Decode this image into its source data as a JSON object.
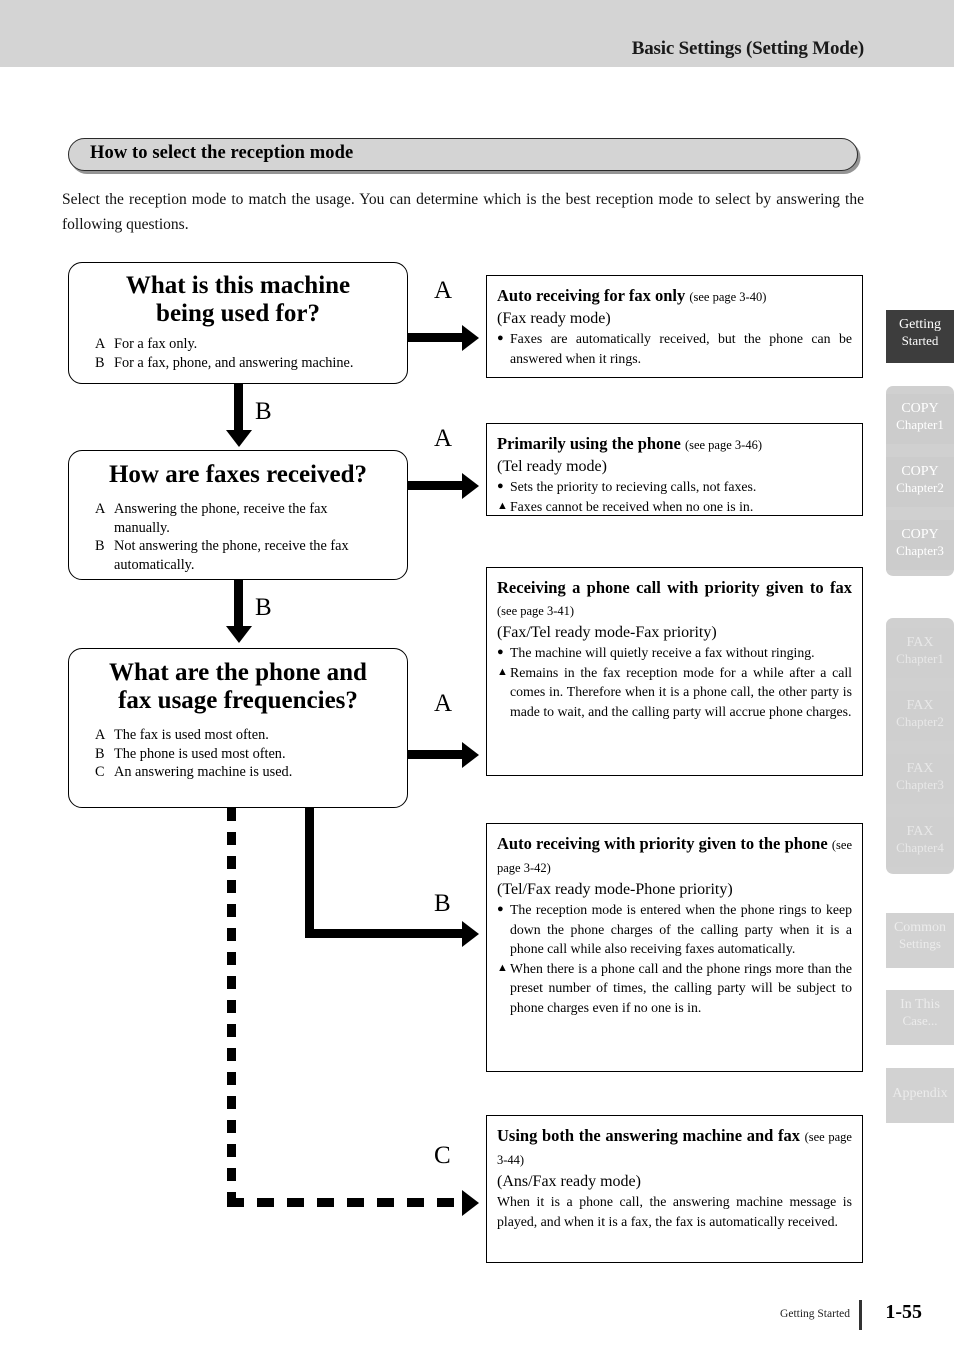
{
  "header": {
    "title": "Basic Settings (Setting Mode)"
  },
  "section": {
    "title": "How to select the reception mode",
    "intro": "Select the reception mode to match the usage. You can determine which is the best reception mode to select by answering the following questions."
  },
  "flow": {
    "questions": [
      {
        "title_line1": "What is this machine",
        "title_line2": "being used for?",
        "options": [
          {
            "letter": "A",
            "text": "For a fax only."
          },
          {
            "letter": "B",
            "text": "For a fax, phone, and answering machine."
          }
        ]
      },
      {
        "title_line1": "How are faxes received?",
        "title_line2": "",
        "options": [
          {
            "letter": "A",
            "text": "Answering the phone, receive the fax manually."
          },
          {
            "letter": "B",
            "text": "Not answering the phone, receive the fax automatically."
          }
        ]
      },
      {
        "title_line1": "What are the phone and",
        "title_line2": "fax usage frequencies?",
        "options": [
          {
            "letter": "A",
            "text": "The fax is used most often."
          },
          {
            "letter": "B",
            "text": "The phone is used most often."
          },
          {
            "letter": "C",
            "text": "An answering machine is used."
          }
        ]
      }
    ],
    "branch_labels": {
      "q1_right": "A",
      "q1_down": "B",
      "q2_right": "A",
      "q2_down": "B",
      "q3_right": "A",
      "q3_mid": "B",
      "q3_dashed": "C"
    },
    "results": [
      {
        "heading": "Auto receiving for fax only",
        "pageref": "(see page 3-40)",
        "mode": "(Fax ready mode)",
        "bullets": [
          {
            "mark": "●",
            "text": "Faxes are automatically received, but the phone can be answered when it rings."
          }
        ],
        "plain": ""
      },
      {
        "heading": "Primarily using the phone",
        "pageref": "(see page 3-46)",
        "mode": "(Tel ready mode)",
        "bullets": [
          {
            "mark": "●",
            "text": "Sets the priority to recieving calls, not faxes."
          },
          {
            "mark": "▲",
            "text": "Faxes cannot be received when no one is in."
          }
        ],
        "plain": ""
      },
      {
        "heading": "Receiving a phone call with priority given to fax",
        "pageref": "(see page 3-41)",
        "mode": "(Fax/Tel ready mode-Fax priority)",
        "bullets": [
          {
            "mark": "●",
            "text": "The machine will quietly receive a fax without ringing."
          },
          {
            "mark": "▲",
            "text": "Remains in the fax reception mode for a while after a call comes in. Therefore when it is a phone call, the other party is made to wait, and the calling party will accrue phone charges."
          }
        ],
        "plain": ""
      },
      {
        "heading": "Auto receiving with priority given to the phone",
        "pageref": "(see page 3-42)",
        "mode": "(Tel/Fax ready mode-Phone priority)",
        "bullets": [
          {
            "mark": "●",
            "text": "The reception mode is entered when the phone rings to keep down the phone charges of the calling party when it is a phone call while also receiving faxes automatically."
          },
          {
            "mark": "▲",
            "text": "When there is a phone call and the phone rings more than the preset number of times, the calling party will be subject to phone charges even if no one is in."
          }
        ],
        "plain": ""
      },
      {
        "heading": "Using both the answering machine and fax",
        "pageref": "(see page 3-44)",
        "mode": "(Ans/Fax ready mode)",
        "bullets": [],
        "plain": "When it is a phone call, the answering machine message is played, and when it is a fax, the fax is automatically received."
      }
    ]
  },
  "tabs": [
    {
      "line1": "Getting",
      "line2": "Started",
      "state": "current"
    },
    {
      "line1": "COPY",
      "line2": "Chapter1",
      "state": "group"
    },
    {
      "line1": "COPY",
      "line2": "Chapter2",
      "state": "group"
    },
    {
      "line1": "COPY",
      "line2": "Chapter3",
      "state": "group"
    },
    {
      "line1": "FAX",
      "line2": "Chapter1",
      "state": "group"
    },
    {
      "line1": "FAX",
      "line2": "Chapter2",
      "state": "group"
    },
    {
      "line1": "FAX",
      "line2": "Chapter3",
      "state": "group"
    },
    {
      "line1": "FAX",
      "line2": "Chapter4",
      "state": "group"
    },
    {
      "line1": "Common",
      "line2": "Settings",
      "state": "single"
    },
    {
      "line1": "In This",
      "line2": "Case...",
      "state": "single"
    },
    {
      "line1": "Appendix",
      "line2": "",
      "state": "single"
    }
  ],
  "footer": {
    "label": "Getting Started",
    "page": "1-55"
  },
  "colors": {
    "header_band": "#d4d4d4",
    "pill_fill": "#d4d4d4",
    "tab_current_bg": "#3d3d3d",
    "tab_group_bg": "#cccccc"
  }
}
